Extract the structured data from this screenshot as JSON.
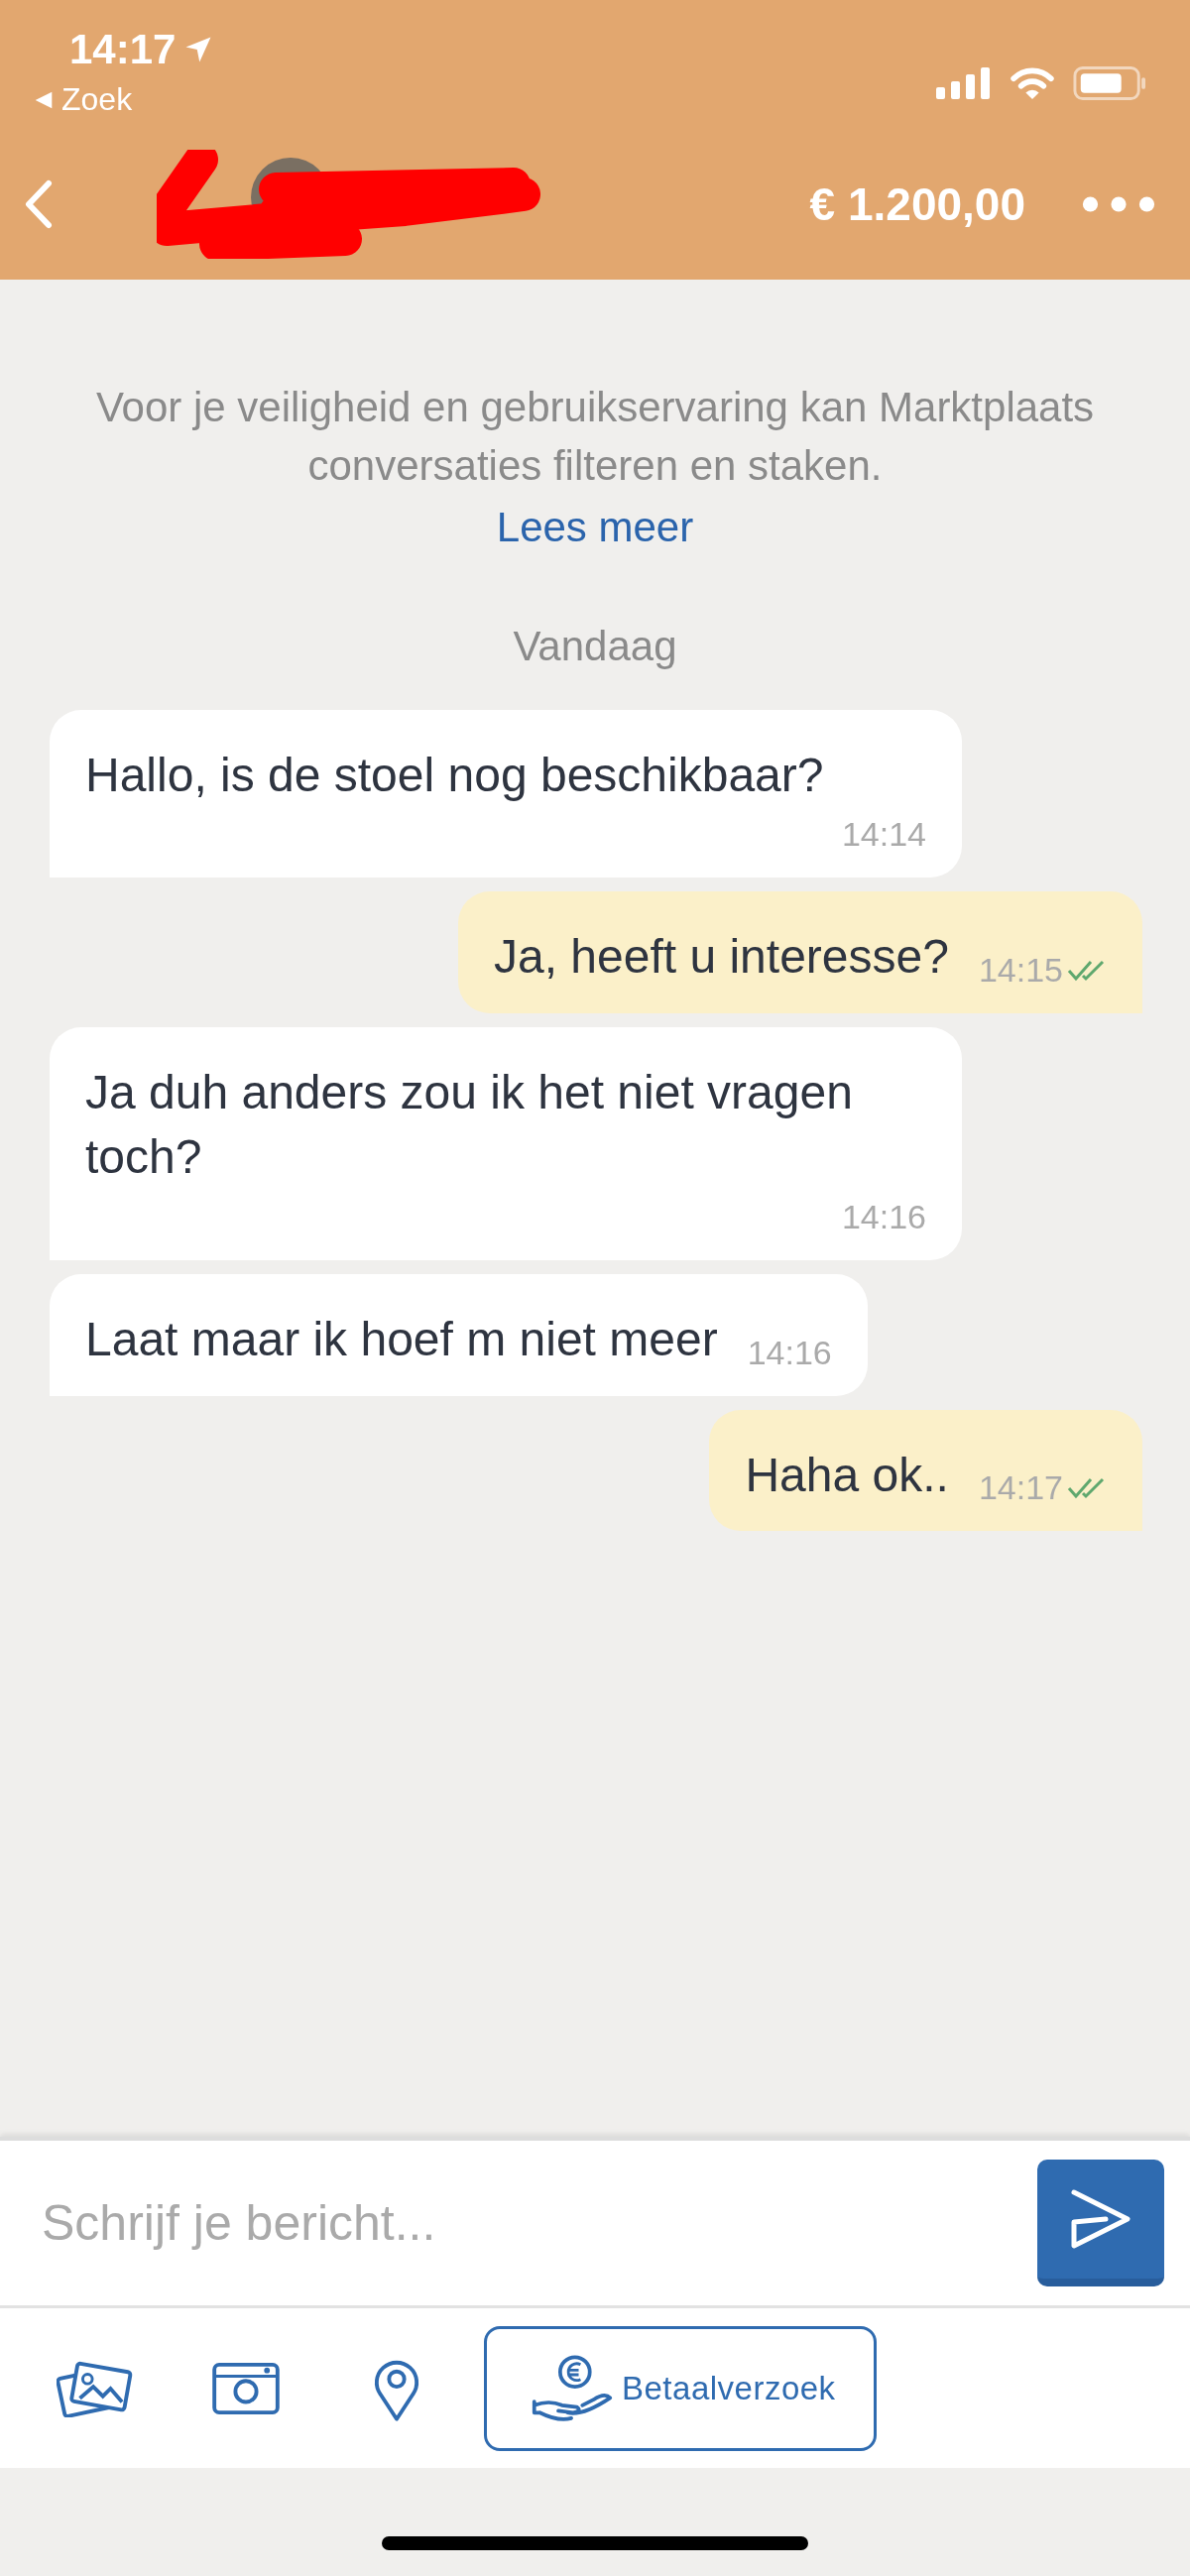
{
  "status_bar": {
    "time": "14:17",
    "back_app": "Zoek"
  },
  "header": {
    "price": "€ 1.200,00"
  },
  "notice": {
    "text": "Voor je veiligheid en gebruikservaring kan Marktplaats conversaties filteren en staken.",
    "link": "Lees meer"
  },
  "date_separator": "Vandaag",
  "messages": [
    {
      "kind": "received",
      "text": "Hallo, is de stoel nog beschikbaar?",
      "time": "14:14"
    },
    {
      "kind": "sent",
      "text": "Ja, heeft u interesse?",
      "time": "14:15",
      "read": true
    },
    {
      "kind": "received",
      "text": "Ja duh anders zou ik het niet vragen toch?",
      "time": "14:16"
    },
    {
      "kind": "received",
      "text": "Laat maar ik hoef m niet meer",
      "time": "14:16"
    },
    {
      "kind": "sent",
      "text": "Haha ok..",
      "time": "14:17",
      "read": true
    }
  ],
  "composer": {
    "placeholder": "Schrijf je bericht..."
  },
  "toolbar": {
    "payment_request": "Betaalverzoek"
  }
}
